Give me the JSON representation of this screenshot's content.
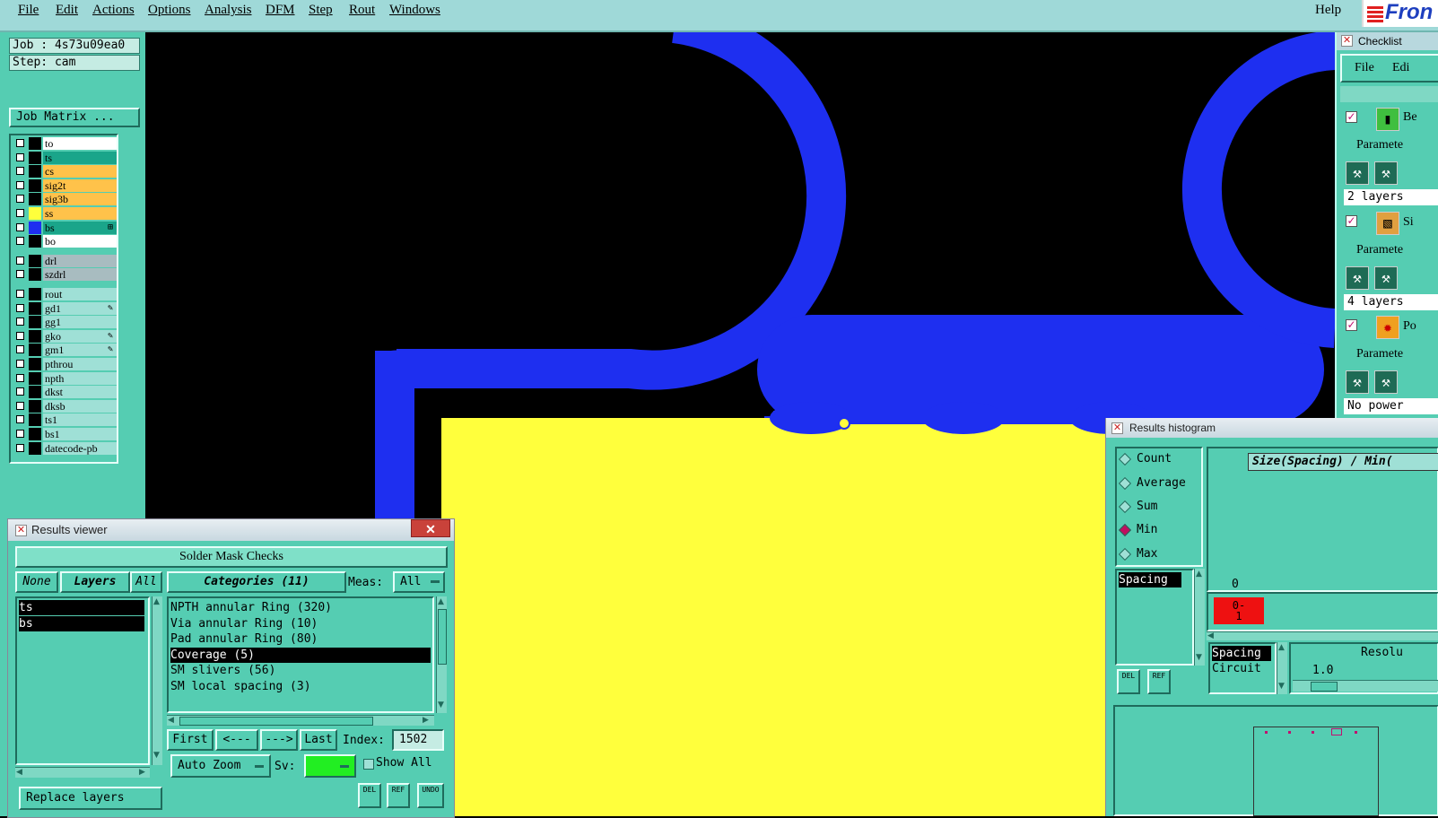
{
  "menubar": {
    "items": [
      "File",
      "Edit",
      "Actions",
      "Options",
      "Analysis",
      "DFM",
      "Step",
      "Rout",
      "Windows"
    ],
    "help": "Help",
    "logo_text": "Fron"
  },
  "job": {
    "job_label": "Job : 4s73u09ea0",
    "step_label": "Step: cam",
    "matrix_button": "Job Matrix ..."
  },
  "layers": [
    {
      "name": "to",
      "bg": "#ffffff",
      "swatch": "#000000",
      "mark": ""
    },
    {
      "name": "ts",
      "bg": "#1aa58a",
      "swatch": "#000000",
      "mark": ""
    },
    {
      "name": "cs",
      "bg": "#ffc24a",
      "swatch": "#000000",
      "mark": ""
    },
    {
      "name": "sig2t",
      "bg": "#ffc24a",
      "swatch": "#000000",
      "mark": ""
    },
    {
      "name": "sig3b",
      "bg": "#ffc24a",
      "swatch": "#000000",
      "mark": ""
    },
    {
      "name": "ss",
      "bg": "#ffc24a",
      "swatch": "#ffff3c",
      "mark": ""
    },
    {
      "name": "bs",
      "bg": "#1aa58a",
      "swatch": "#1e2ff0",
      "mark": "⊞"
    },
    {
      "name": "bo",
      "bg": "#ffffff",
      "swatch": "#000000",
      "mark": ""
    },
    {
      "name": "drl",
      "bg": "#a8bcc0",
      "swatch": "#000000",
      "mark": ""
    },
    {
      "name": "szdrl",
      "bg": "#a8bcc0",
      "swatch": "#000000",
      "mark": ""
    },
    {
      "name": "rout",
      "bg": "#9fe0d6",
      "swatch": "#000000",
      "mark": ""
    },
    {
      "name": "gd1",
      "bg": "#9fe0d6",
      "swatch": "#000000",
      "mark": "✎"
    },
    {
      "name": "gg1",
      "bg": "#9fe0d6",
      "swatch": "#000000",
      "mark": ""
    },
    {
      "name": "gko",
      "bg": "#9fe0d6",
      "swatch": "#000000",
      "mark": "✎"
    },
    {
      "name": "gm1",
      "bg": "#9fe0d6",
      "swatch": "#000000",
      "mark": "✎"
    },
    {
      "name": "pthrou",
      "bg": "#9fe0d6",
      "swatch": "#000000",
      "mark": ""
    },
    {
      "name": "npth",
      "bg": "#9fe0d6",
      "swatch": "#000000",
      "mark": ""
    },
    {
      "name": "dkst",
      "bg": "#9fe0d6",
      "swatch": "#000000",
      "mark": ""
    },
    {
      "name": "dksb",
      "bg": "#9fe0d6",
      "swatch": "#000000",
      "mark": ""
    },
    {
      "name": "ts1",
      "bg": "#9fe0d6",
      "swatch": "#000000",
      "mark": ""
    },
    {
      "name": "bs1",
      "bg": "#9fe0d6",
      "swatch": "#000000",
      "mark": ""
    },
    {
      "name": "datecode-pb",
      "bg": "#9fe0d6",
      "swatch": "#000000",
      "mark": ""
    }
  ],
  "checklist": {
    "title": "Checklist",
    "menu_file": "File",
    "menu_edit": "Edi",
    "item1": "Be",
    "item2": "Si",
    "item3": "Po",
    "param": "Paramete",
    "layers1": "2 layers",
    "layers2": "4 layers",
    "status3": "No power"
  },
  "results_viewer": {
    "title": "Results viewer",
    "close": "✕",
    "header": "Solder Mask Checks",
    "none_btn": "None",
    "layers_btn": "Layers",
    "all_btn": "All",
    "layer_list": [
      "ts",
      "bs"
    ],
    "categories_btn": "Categories (11)",
    "meas_label": "Meas:",
    "meas_value": "All",
    "categories": [
      "NPTH annular Ring (320)",
      "Via annular Ring (10)",
      "Pad annular Ring (80)",
      "Coverage (5)",
      "SM slivers (56)",
      "SM local spacing (3)"
    ],
    "selected_category": 3,
    "first_btn": "First",
    "prev_btn": "<---",
    "next_btn": "--->",
    "last_btn": "Last",
    "index_label": "Index:",
    "index_value": "1502",
    "autozoom": "Auto Zoom",
    "sv_label": "Sv:",
    "show_all": "Show All",
    "replace_layers": "Replace layers",
    "del_btn": "DEL",
    "ref_btn": "REF",
    "undo_btn": "UNDO"
  },
  "histogram": {
    "title": "Results histogram",
    "radios": [
      "Count",
      "Average",
      "Sum",
      "Min",
      "Max"
    ],
    "selected_radio": 3,
    "measure_list": [
      "Spacing"
    ],
    "chart_title": "Size(Spacing) / Min(",
    "zero_label": "0",
    "bin_label": "0-\n1",
    "del_btn": "DEL",
    "ref_btn": "REF",
    "list2": [
      "Spacing",
      "Circuit"
    ],
    "resolution_label": "Resolu",
    "resolution_value": "1.0"
  },
  "colors": {
    "board_blue": "#1e2ff0",
    "board_yellow": "#ffff3c",
    "panel_teal": "#55cdb2",
    "sv_green": "#22ee22",
    "bin_red": "#ee1111"
  }
}
